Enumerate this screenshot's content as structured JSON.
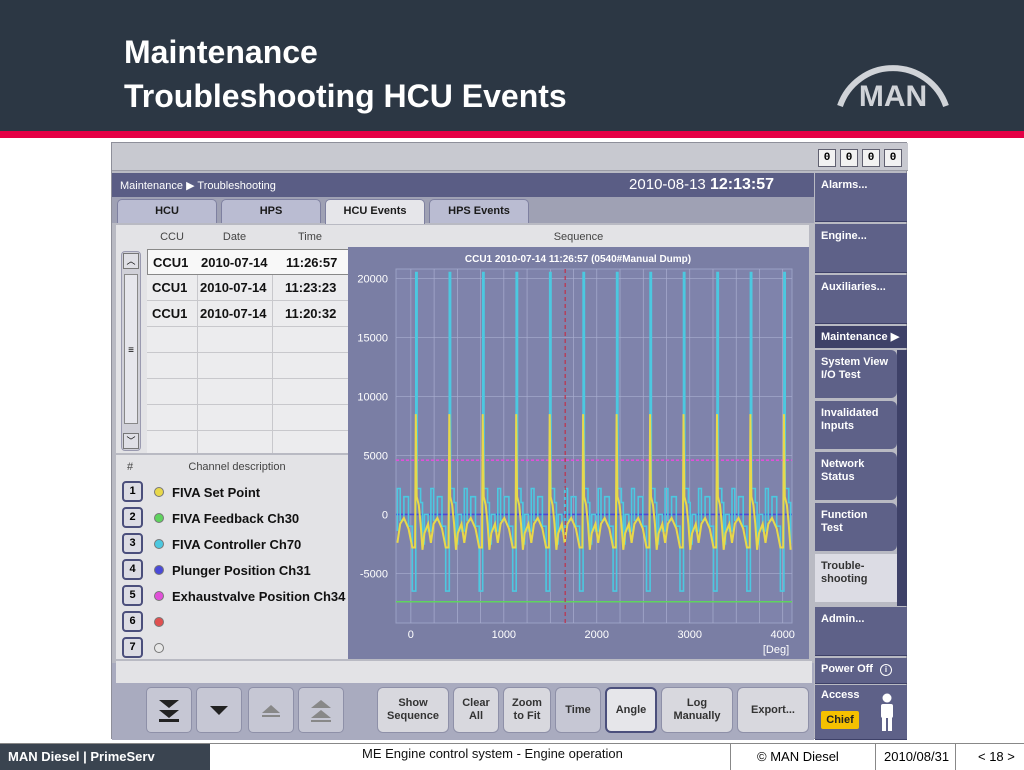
{
  "slide": {
    "title_line1": "Maintenance",
    "title_line2": "Troubleshooting HCU Events",
    "logo_text": "MAN"
  },
  "counters": [
    "0",
    "0",
    "0",
    "0"
  ],
  "breadcrumb": {
    "part1": "Maintenance",
    "part2": "Troubleshooting"
  },
  "datetime": {
    "date": "2010-08-13",
    "time": "12:13:57"
  },
  "tabs": [
    {
      "label": "HCU",
      "active": false
    },
    {
      "label": "HPS",
      "active": false
    },
    {
      "label": "HCU Events",
      "active": true
    },
    {
      "label": "HPS Events",
      "active": false
    }
  ],
  "events_table": {
    "headers": [
      "CCU",
      "Date",
      "Time",
      "Sequence"
    ],
    "rows": [
      {
        "ccu": "CCU1",
        "date": "2010-07-14",
        "time": "11:26:57"
      },
      {
        "ccu": "CCU1",
        "date": "2010-07-14",
        "time": "11:23:23"
      },
      {
        "ccu": "CCU1",
        "date": "2010-07-14",
        "time": "11:20:32"
      }
    ]
  },
  "channels": {
    "headers": [
      "#",
      "Channel description"
    ],
    "items": [
      {
        "num": "1",
        "label": "FIVA Set Point",
        "color": "#e8d84a"
      },
      {
        "num": "2",
        "label": "FIVA Feedback Ch30",
        "color": "#5fd35f"
      },
      {
        "num": "3",
        "label": "FIVA Controller Ch70",
        "color": "#4cc8e0"
      },
      {
        "num": "4",
        "label": "Plunger Position Ch31",
        "color": "#4a4ad8"
      },
      {
        "num": "5",
        "label": "Exhaustvalve Position Ch34",
        "color": "#e050d8"
      },
      {
        "num": "6",
        "label": "",
        "color": "#e05050"
      },
      {
        "num": "7",
        "label": "",
        "color": "#e8e8e8"
      }
    ]
  },
  "side_menu": {
    "alarms": "Alarms...",
    "engine": "Engine...",
    "auxiliaries": "Auxiliaries...",
    "maintenance": "Maintenance",
    "sub": [
      {
        "line1": "System View",
        "line2": "I/O Test",
        "active": false
      },
      {
        "line1": "Invalidated",
        "line2": "Inputs",
        "active": false
      },
      {
        "line1": "Network",
        "line2": "Status",
        "active": false
      },
      {
        "line1": "Function",
        "line2": "Test",
        "active": false
      },
      {
        "line1": "Trouble-",
        "line2": "shooting",
        "active": true
      }
    ],
    "admin": "Admin...",
    "power_off": "Power Off",
    "access": "Access",
    "access_level": "Chief"
  },
  "bottom_buttons": {
    "show_sequence": [
      "Show",
      "Sequence"
    ],
    "clear_all": [
      "Clear",
      "All"
    ],
    "zoom_to_fit": [
      "Zoom",
      "to Fit"
    ],
    "time": "Time",
    "angle": "Angle",
    "log_manually": [
      "Log",
      "Manually"
    ],
    "export": "Export..."
  },
  "footer": {
    "brand": "MAN Diesel | PrimeServ",
    "caption": "ME Engine control system - Engine operation",
    "copyright": "© MAN Diesel",
    "date": "2010/08/31",
    "page": "< 18 >"
  },
  "chart_data": {
    "type": "line",
    "title": "CCU1 2010-07-14 11:26:57 (0540#Manual Dump)",
    "xlabel": "[Deg]",
    "ylabel": "",
    "xlim": [
      -160,
      4100
    ],
    "ylim": [
      -9200,
      20800
    ],
    "xticks": [
      0,
      1000,
      2000,
      3000,
      4000
    ],
    "yticks": [
      -5000,
      0,
      5000,
      10000,
      15000,
      20000
    ],
    "grid": true,
    "legend": "none",
    "cursor_x": 1660,
    "cycle_deg": 360,
    "cycle_offset_deg": 45,
    "series": [
      {
        "id": "exhaust",
        "color": "#e050d8",
        "style": "constant",
        "value": 4600
      },
      {
        "id": "plunger",
        "color": "#4a4ad8",
        "style": "constant",
        "value": 0
      },
      {
        "id": "feedback",
        "color": "#5fd35f",
        "style": "constant",
        "value": -7400
      },
      {
        "id": "controller",
        "color": "#4cc8e0",
        "style": "periodic",
        "profile": [
          [
            0,
            -6500
          ],
          [
            8,
            -6500
          ],
          [
            8,
            20500
          ],
          [
            22,
            20500
          ],
          [
            22,
            2200
          ],
          [
            60,
            2200
          ],
          [
            60,
            1000
          ],
          [
            80,
            1000
          ],
          [
            80,
            -2500
          ],
          [
            100,
            -2500
          ],
          [
            100,
            0
          ],
          [
            140,
            0
          ],
          [
            140,
            -1400
          ],
          [
            170,
            -1400
          ],
          [
            170,
            2200
          ],
          [
            200,
            2200
          ],
          [
            200,
            -500
          ],
          [
            240,
            -500
          ],
          [
            240,
            1500
          ],
          [
            290,
            1500
          ],
          [
            290,
            -1000
          ],
          [
            330,
            -1000
          ],
          [
            330,
            -6500
          ],
          [
            360,
            -6500
          ]
        ]
      },
      {
        "id": "setpoint",
        "color": "#e8d84a",
        "style": "periodic",
        "profile": [
          [
            0,
            -2800
          ],
          [
            8,
            8500
          ],
          [
            18,
            1500
          ],
          [
            40,
            800
          ],
          [
            60,
            -800
          ],
          [
            80,
            -3000
          ],
          [
            100,
            -1600
          ],
          [
            140,
            -800
          ],
          [
            170,
            -2400
          ],
          [
            200,
            -800
          ],
          [
            240,
            -300
          ],
          [
            290,
            -1200
          ],
          [
            330,
            -2800
          ],
          [
            360,
            -2800
          ]
        ]
      }
    ]
  }
}
